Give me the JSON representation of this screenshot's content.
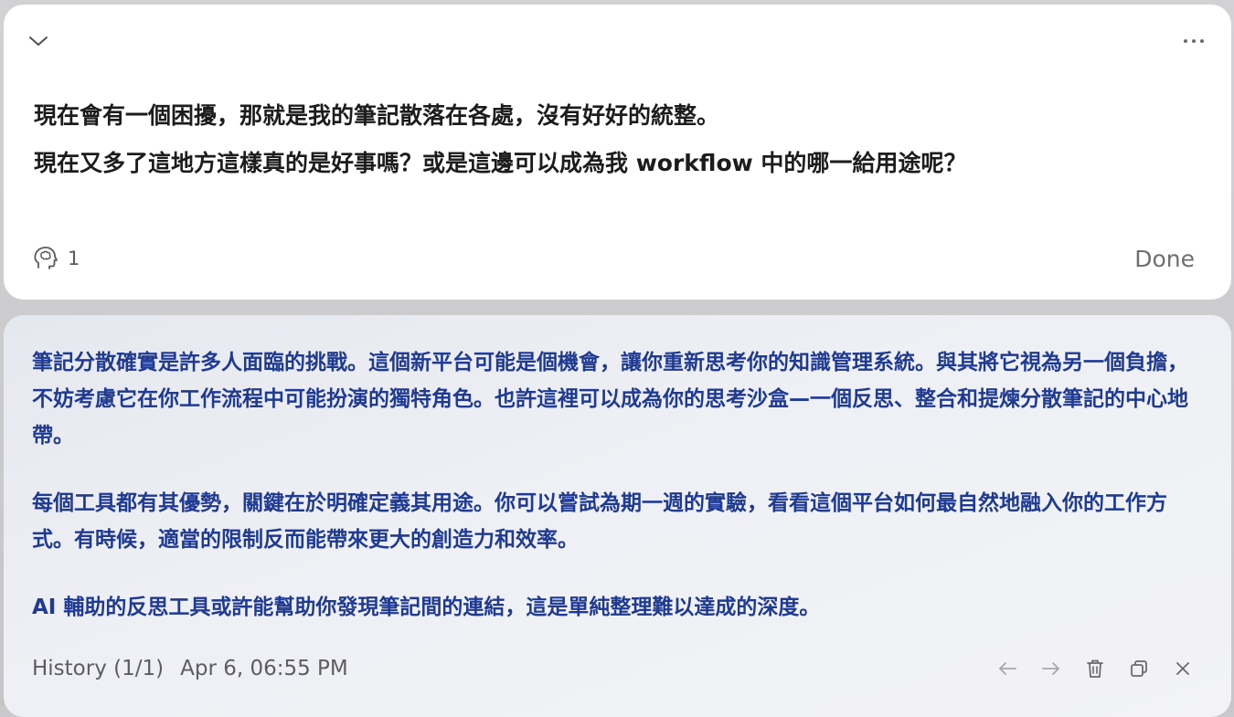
{
  "prompt_card": {
    "lines": [
      "現在會有一個困擾，那就是我的筆記散落在各處，沒有好好的統整。",
      "現在又多了這地方這樣真的是好事嗎？或是這邊可以成為我 workflow 中的哪一給用途呢？"
    ],
    "thought_count": "1",
    "done_label": "Done",
    "icons": {
      "collapse": "chevron-down-icon",
      "more": "more-horizontal-icon",
      "thought": "brain-head-icon"
    }
  },
  "response_card": {
    "paragraphs": [
      "筆記分散確實是許多人面臨的挑戰。這個新平台可能是個機會，讓你重新思考你的知識管理系統。與其將它視為另一個負擔，不妨考慮它在你工作流程中可能扮演的獨特角色。也許這裡可以成為你的思考沙盒—一個反思、整合和提煉分散筆記的中心地帶。",
      "每個工具都有其優勢，關鍵在於明確定義其用途。你可以嘗試為期一週的實驗，看看這個平台如何最自然地融入你的工作方式。有時候，適當的限制反而能帶來更大的創造力和效率。",
      "AI 輔助的反思工具或許能幫助你發現筆記間的連結，這是單純整理難以達成的深度。"
    ],
    "history_label": "History (1/1)",
    "timestamp": "Apr 6, 06:55 PM",
    "icons": {
      "back": "arrow-left-icon",
      "forward": "arrow-right-icon",
      "delete": "trash-icon",
      "copy": "copy-icon",
      "close": "close-icon"
    }
  },
  "colors": {
    "prompt_text": "#1c1c1e",
    "response_text": "#1f3a93",
    "muted": "#6f6f73"
  }
}
